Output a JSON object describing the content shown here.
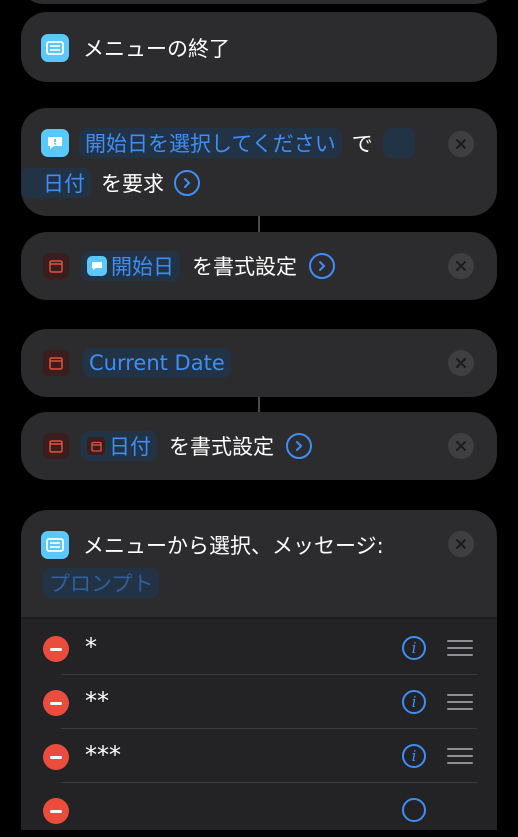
{
  "actions": {
    "end_menu": {
      "label": "メニューの終了"
    },
    "ask_input": {
      "prompt_token": "開始日を選択してください",
      "text_de": "で",
      "type_token": "日付",
      "text_request": "を要求"
    },
    "format_date_1": {
      "token": "開始日",
      "text": "を書式設定"
    },
    "current_date": {
      "token": "Current Date"
    },
    "format_date_2": {
      "token": "日付",
      "text": "を書式設定"
    },
    "choose_menu": {
      "label": "メニューから選択、メッセージ:",
      "placeholder_token": "プロンプト",
      "items": [
        "*",
        "**",
        "***"
      ]
    }
  },
  "colors": {
    "background": "#000000",
    "card": "#2c2c2e",
    "accent": "#3e8ef7",
    "delete": "#eb4d3d",
    "scripting_icon": "#5ac8fa"
  }
}
